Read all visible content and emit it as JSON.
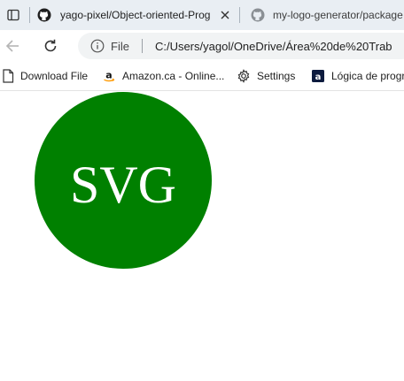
{
  "tabs": [
    {
      "title": "yago-pixel/Object-oriented-Prog",
      "icon": "github-icon"
    },
    {
      "title": "my-logo-generator/package",
      "icon": "github-icon"
    }
  ],
  "address": {
    "security_label": "File",
    "url": "C:/Users/yagol/OneDrive/Área%20de%20Trab"
  },
  "favorites": [
    {
      "label": "Download File",
      "icon": "document-icon"
    },
    {
      "label": "Amazon.ca - Online...",
      "icon": "amazon-icon"
    },
    {
      "label": "Settings",
      "icon": "gear-icon"
    },
    {
      "label": "Lógica de progr",
      "icon": "bookmark-a-icon"
    }
  ],
  "logo": {
    "text": "SVG",
    "shape": "circle",
    "shape_color": "#008000",
    "text_color": "#ffffff"
  }
}
